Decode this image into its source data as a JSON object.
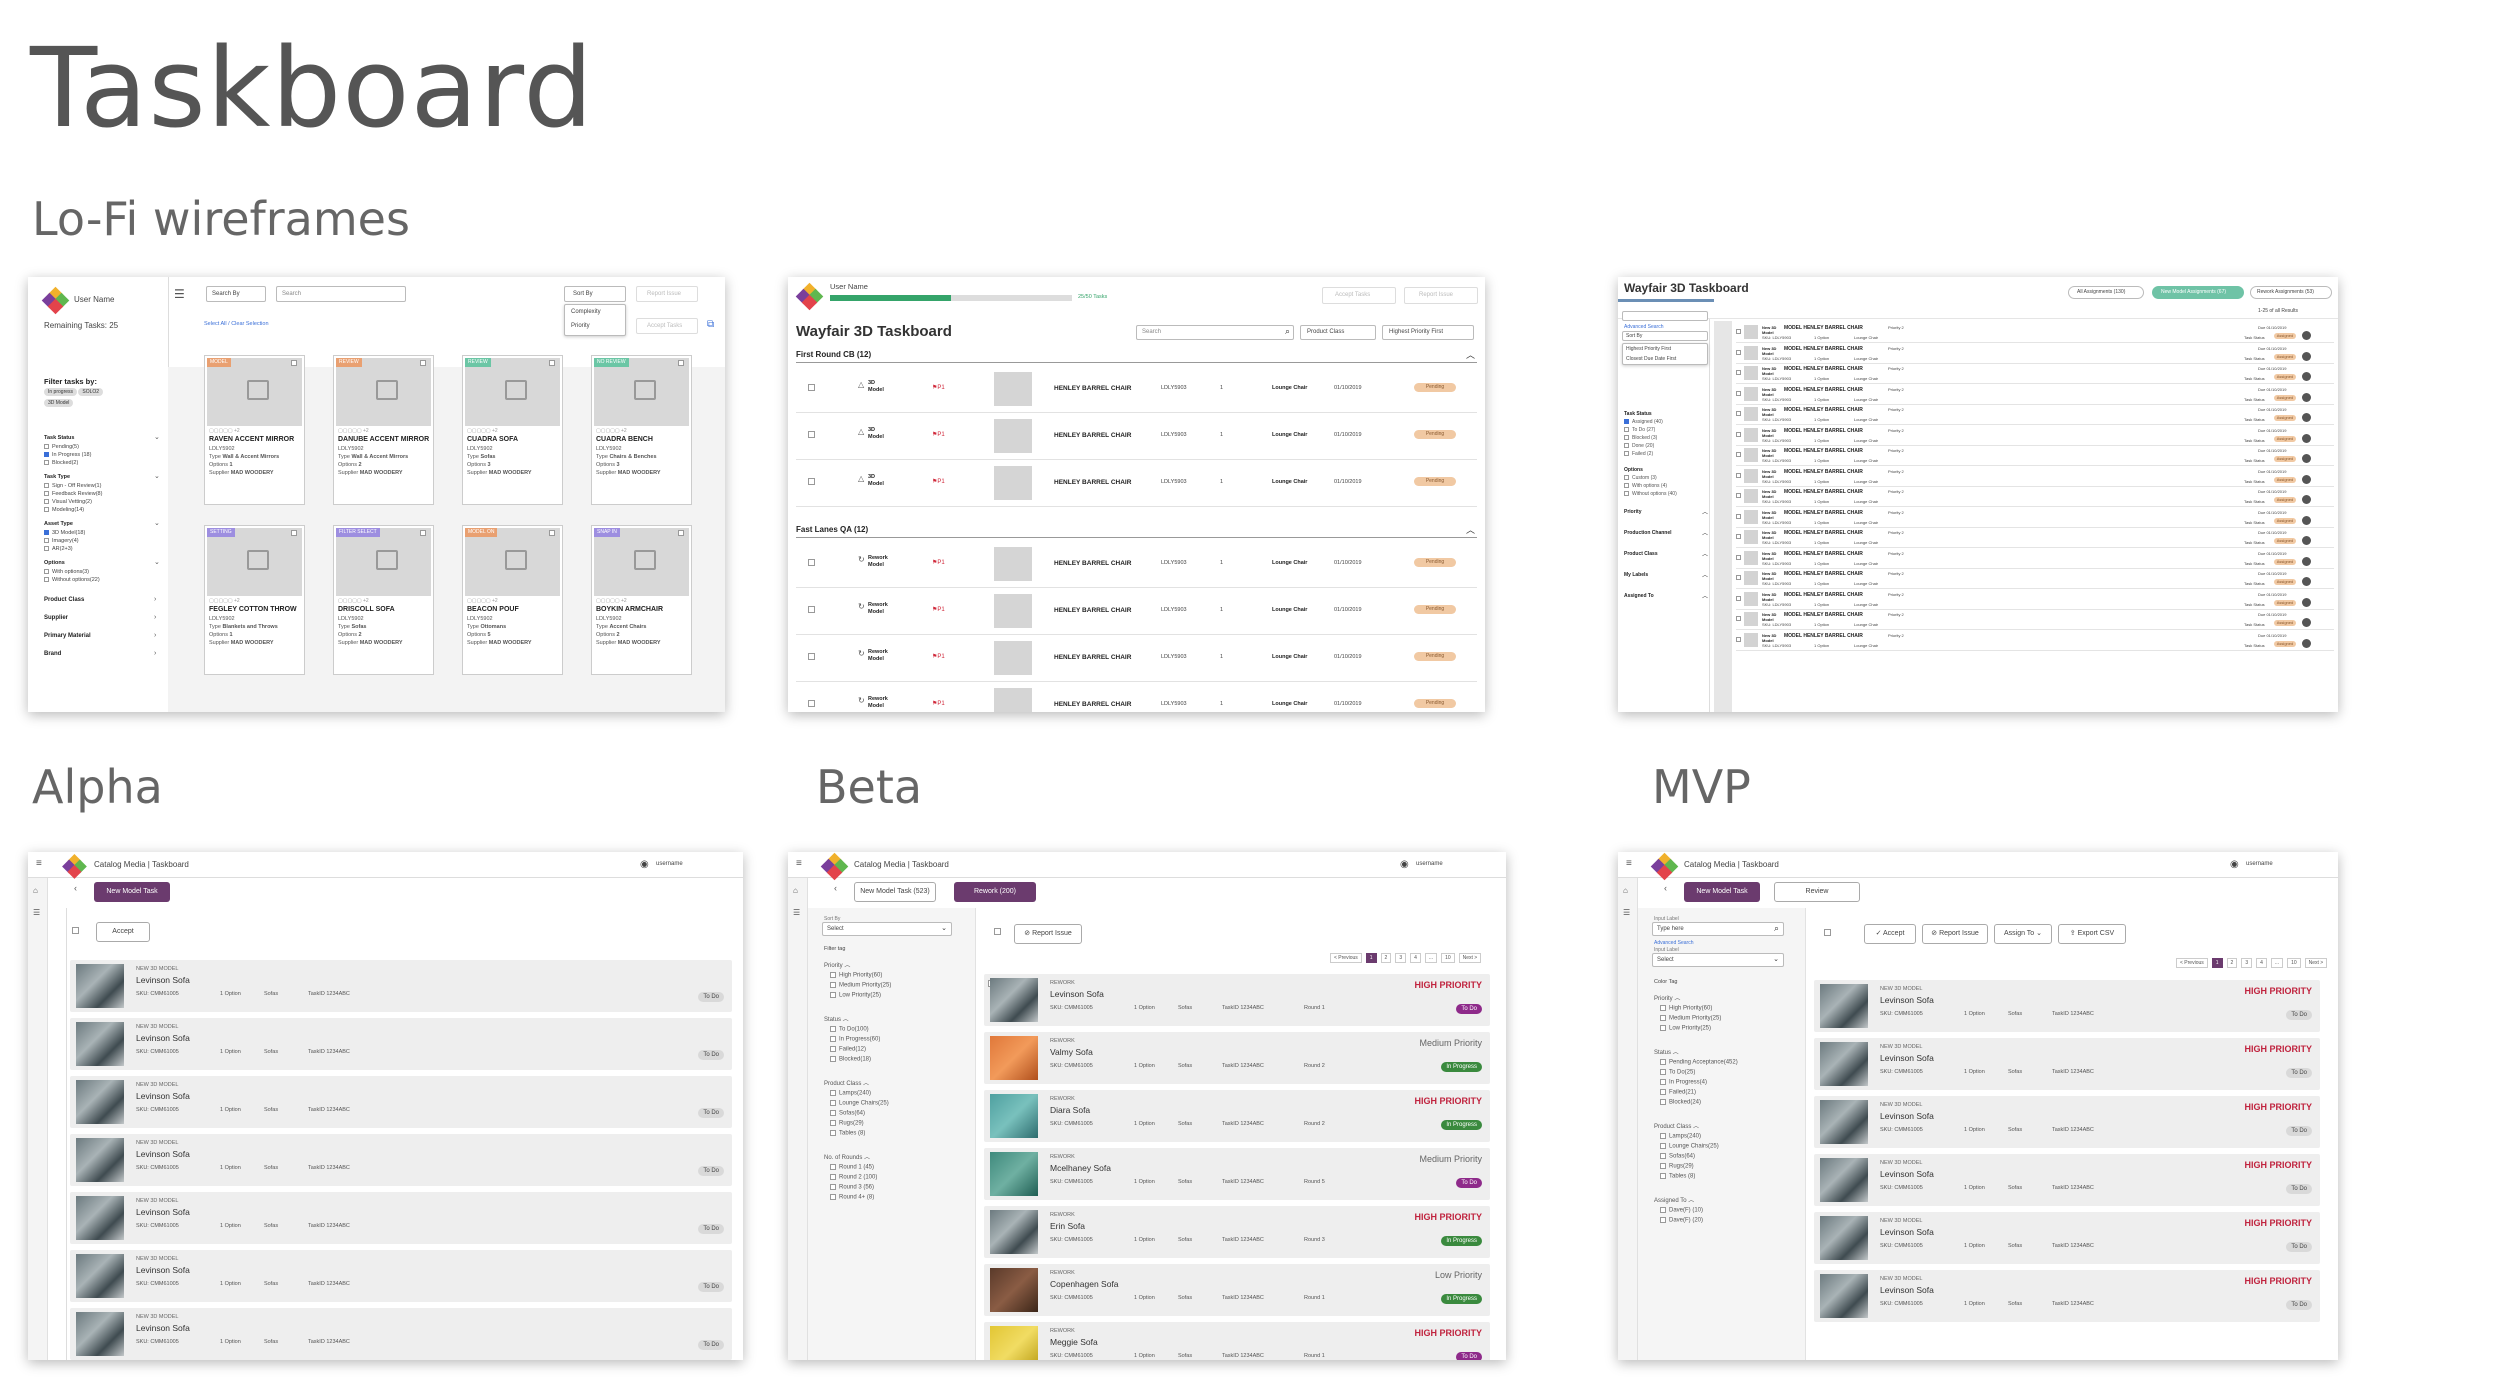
{
  "page": {
    "title": "Taskboard",
    "sections": {
      "lofi": "Lo-Fi wireframes",
      "alpha": "Alpha",
      "beta": "Beta",
      "mvp": "MVP"
    }
  },
  "colors": {
    "purple": "#6b3b6e",
    "high_priority": "#c0233e",
    "in_progress": "#3a8a3e",
    "pending": "#f1c9a3",
    "green_bar": "#35a46a"
  },
  "wf1": {
    "user_name": "User Name",
    "remaining": "Remaining Tasks: 25",
    "search_by": "Search By",
    "search_placeholder": "Search",
    "sort_by": "Sort By",
    "sort_options": [
      "Complexity",
      "Priority"
    ],
    "report_issue": "Report Issue",
    "accept_tasks": "Accept Tasks",
    "select_all": "Select All / Clear Selection",
    "filter_title": "Filter tasks by:",
    "filter_chips": [
      "In progress",
      "SOLO2",
      "3D Model"
    ],
    "groups": [
      {
        "title": "Task Status",
        "items": [
          "Pending(5)",
          "In Progress (18)",
          "Blocked(2)"
        ]
      },
      {
        "title": "Task Type",
        "items": [
          "Sign - Off Review(1)",
          "Feedback Review(8)",
          "Visual Vetting(2)",
          "Modeling(14)"
        ]
      },
      {
        "title": "Asset Type",
        "items": [
          "3D Model(18)",
          "Imagery(4)",
          "AR(2+3)"
        ]
      },
      {
        "title": "Options",
        "items": [
          "With options(3)",
          "Without options(22)"
        ]
      }
    ],
    "collapsed": [
      "Product Class",
      "Supplier",
      "Primary Material",
      "Brand"
    ],
    "cards": [
      {
        "tag": "MODEL",
        "tag_color": "#e9a071",
        "name": "RAVEN ACCENT MIRROR",
        "sku": "LDLY5902",
        "type": "Wall & Accent Mirrors",
        "options": "1",
        "supplier": "MAD WOODERY"
      },
      {
        "tag": "REVIEW",
        "tag_color": "#e9a071",
        "name": "DANUBE ACCENT MIRROR",
        "sku": "LDLY5902",
        "type": "Wall & Accent Mirrors",
        "options": "2",
        "supplier": "MAD WOODERY"
      },
      {
        "tag": "REVIEW",
        "tag_color": "#6bc6a5",
        "name": "CUADRA SOFA",
        "sku": "LDLY5902",
        "type": "Sofas",
        "options": "3",
        "supplier": "MAD WOODERY"
      },
      {
        "tag": "NO REVIEW",
        "tag_color": "#6bc6a5",
        "name": "CUADRA BENCH",
        "sku": "LDLY5902",
        "type": "Chairs & Benches",
        "options": "3",
        "supplier": "MAD WOODERY"
      },
      {
        "tag": "SETTING",
        "tag_color": "#9d8ee0",
        "name": "FEGLEY COTTON THROW",
        "sku": "LDLY5902",
        "type": "Blankets and Throws",
        "options": "1",
        "supplier": "MAD WOODERY"
      },
      {
        "tag": "FILTER SELECT",
        "tag_color": "#9d8ee0",
        "name": "DRISCOLL SOFA",
        "sku": "LDLY5902",
        "type": "Sofas",
        "options": "2",
        "supplier": "MAD WOODERY"
      },
      {
        "tag": "MODEL ON",
        "tag_color": "#e9a071",
        "name": "BEACON POUF",
        "sku": "LDLY5902",
        "type": "Ottomans",
        "options": "5",
        "supplier": "MAD WOODERY"
      },
      {
        "tag": "SNAP IN",
        "tag_color": "#9d8ee0",
        "name": "BOYKIN ARMCHAIR",
        "sku": "LDLY5902",
        "type": "Accent Chairs",
        "options": "2",
        "supplier": "MAD WOODERY"
      }
    ]
  },
  "wf2": {
    "user_name": "User Name",
    "progress_label": "25/50 Tasks",
    "progress": 0.5,
    "accept": "Accept Tasks",
    "report": "Report Issue",
    "title": "Wayfair 3D Taskboard",
    "search_placeholder": "Search",
    "product_class": "Product Class",
    "sort": "Highest Priority First",
    "groups": [
      {
        "title": "First Round CB (12)",
        "type": "3D Model"
      },
      {
        "title": "Fast Lanes QA (12)",
        "type": "Rework Model"
      }
    ],
    "row": {
      "priority": "P1",
      "name": "HENLEY BARREL CHAIR",
      "sku": "LDLY5903",
      "qty": "1",
      "category": "Lounge Chair",
      "date": "01/10/2019",
      "status": "Pending"
    }
  },
  "wf3": {
    "title": "Wayfair 3D Taskboard",
    "tabs": [
      "All Assignments (130)",
      "New Model Assignments (67)",
      "Rework Assignments (53)"
    ],
    "results": "1-25 of all Results",
    "advanced": "Advanced Search",
    "sort_by": "Sort By",
    "sort_options": [
      "Highest Priority First",
      "Closest Due Date First"
    ],
    "task_status": "Task Status",
    "status_items": [
      "Assigned (40)",
      "To Do (27)",
      "Blocked (3)",
      "Done (20)",
      "Failed (2)"
    ],
    "options": "Options",
    "options_items": [
      "Custom (3)",
      "With options (4)",
      "Without options (40)"
    ],
    "collapsed": [
      "Priority",
      "Production Channel",
      "Product Class",
      "My Labels",
      "Assigned To"
    ],
    "row": {
      "new": "New 3D Model",
      "name": "MODEL HENLEY BARREL CHAIR",
      "priority": "Priority 2",
      "due": "Due 01/10/2019",
      "sku": "SKU: LDLY5903",
      "option": "1 Option",
      "category": "Lounge Chair",
      "status_label": "Task Status",
      "status": "Assigned"
    }
  },
  "common": {
    "app": "Catalog Media | Taskboard",
    "username": "username",
    "item_new": "NEW 3D MODEL",
    "item_rework": "REWORK",
    "item_name": "Levinson Sofa",
    "sku": "SKU: CMM61005",
    "option": "1 Option",
    "category": "Sofas",
    "task_id": "TaskID 1234ABC",
    "todo": "To Do"
  },
  "alpha": {
    "new_model_task": "New Model Task",
    "accept": "Accept"
  },
  "beta": {
    "new_model_task": "New Model Task (523)",
    "rework": "Rework (200)",
    "sort_by": "Sort By",
    "select": "Select",
    "report_issue": "Report Issue",
    "filter_tag": "Filter tag",
    "priority": "Priority",
    "priority_items": [
      "High Priority(60)",
      "Medium Priority(25)",
      "Low Priority(25)"
    ],
    "status": "Status",
    "status_items": [
      "To Do(100)",
      "In Progress(60)",
      "Failed(12)",
      "Blocked(18)"
    ],
    "product_class": "Product Class",
    "class_items": [
      "Lamps(240)",
      "Lounge Chairs(25)",
      "Sofas(64)",
      "Rugs(29)",
      "Tables (8)"
    ],
    "rounds": "No. of Rounds",
    "round_items": [
      "Round 1 (45)",
      "Round 2 (100)",
      "Round 3 (56)",
      "Round 4+ (8)"
    ],
    "pagination": [
      "< Previous",
      "1",
      "2",
      "3",
      "4",
      "...",
      "10",
      "Next >"
    ],
    "items": [
      {
        "name": "Levinson Sofa",
        "round": "Round 1",
        "priority": "HIGH PRIORITY",
        "level": "hi",
        "status": "To Do",
        "status_color": "#8e2a8a",
        "thumb": ""
      },
      {
        "name": "Valmy Sofa",
        "round": "Round 2",
        "priority": "Medium Priority",
        "level": "med",
        "status": "In Progress",
        "status_color": "#3a8a3e",
        "thumb": "orange"
      },
      {
        "name": "Diara Sofa",
        "round": "Round 2",
        "priority": "HIGH PRIORITY",
        "level": "hi",
        "status": "In Progress",
        "status_color": "#3a8a3e",
        "thumb": "teal"
      },
      {
        "name": "Mcelhaney Sofa",
        "round": "Round 5",
        "priority": "Medium Priority",
        "level": "med",
        "status": "To Do",
        "status_color": "#8e2a8a",
        "thumb": "green"
      },
      {
        "name": "Erin Sofa",
        "round": "Round 3",
        "priority": "HIGH PRIORITY",
        "level": "hi",
        "status": "In Progress",
        "status_color": "#3a8a3e",
        "thumb": ""
      },
      {
        "name": "Copenhagen Sofa",
        "round": "Round 1",
        "priority": "Low Priority",
        "level": "med",
        "status": "In Progress",
        "status_color": "#3a8a3e",
        "thumb": "brown"
      },
      {
        "name": "Meggie Sofa",
        "round": "Round 1",
        "priority": "HIGH PRIORITY",
        "level": "hi",
        "status": "To Do",
        "status_color": "#8e2a8a",
        "thumb": "yellow"
      }
    ]
  },
  "mvp": {
    "new_model_task": "New Model Task",
    "review": "Review",
    "input_label": "Input Label",
    "type_here": "Type here",
    "select": "Select",
    "advanced": "Advanced Search",
    "accept": "Accept",
    "report_issue": "Report Issue",
    "assign_to": "Assign To",
    "export": "Export CSV",
    "pagination": [
      "< Previous",
      "1",
      "2",
      "3",
      "4",
      "...",
      "10",
      "Next >"
    ],
    "color_tag": "Color Tag",
    "priority": "Priority",
    "priority_items": [
      "High Priority(60)",
      "Medium Priority(25)",
      "Low Priority(25)"
    ],
    "status": "Status",
    "status_items": [
      "Pending Acceptance(452)",
      "To Do(25)",
      "In Progress(4)",
      "Failed(21)",
      "Blocked(24)"
    ],
    "product_class": "Product Class",
    "class_items": [
      "Lamps(240)",
      "Lounge Chairs(25)",
      "Sofas(64)",
      "Rugs(29)",
      "Tables (8)"
    ],
    "assigned_to": "Assigned To",
    "assigned_items": [
      "Dave(F) (10)",
      "Dave(F) (20)"
    ],
    "priority_label": "HIGH PRIORITY"
  }
}
